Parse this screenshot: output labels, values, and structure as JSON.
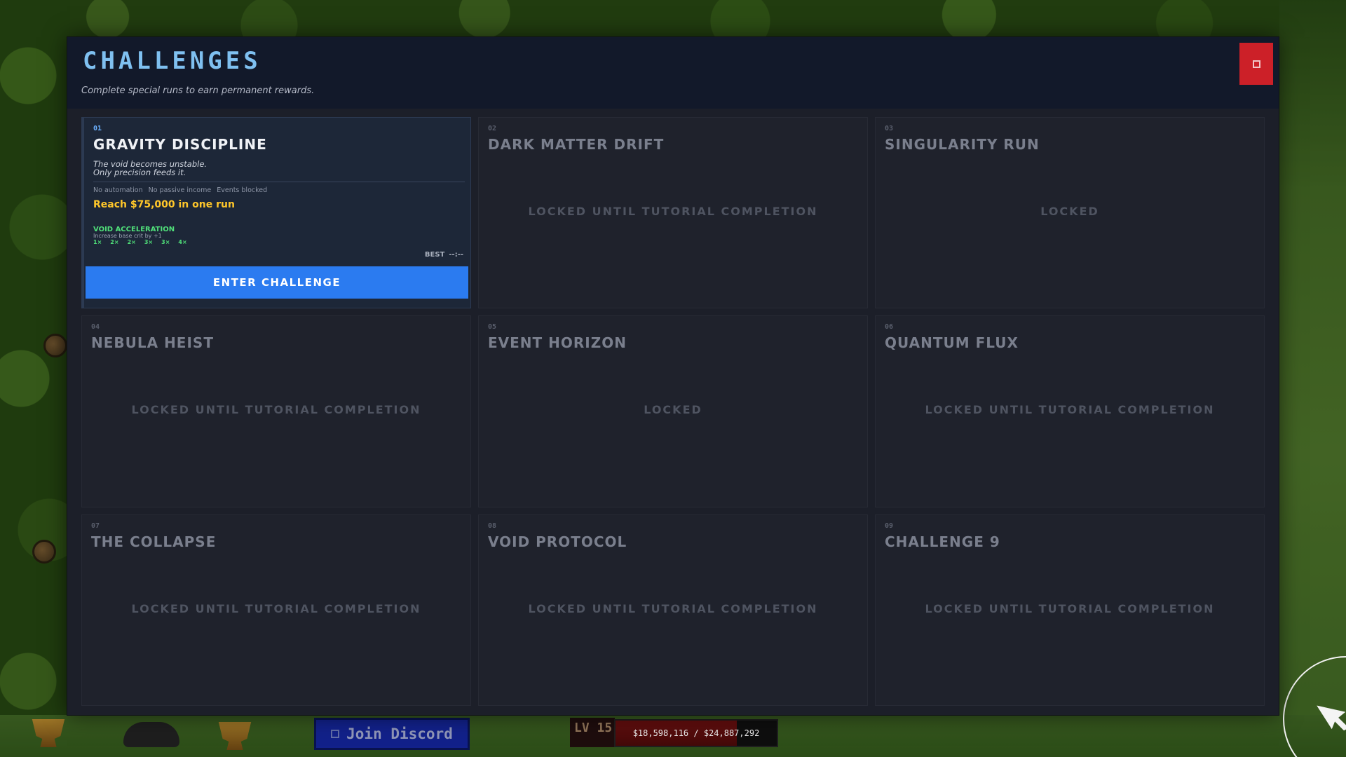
{
  "modal": {
    "title": "CHALLENGES",
    "subtitle": "Complete special runs to earn permanent rewards.",
    "close_icon": "close-icon"
  },
  "challenges": [
    {
      "number": "01",
      "name": "GRAVITY DISCIPLINE",
      "active": true,
      "flavor_line1": "The void becomes unstable.",
      "flavor_line2": "Only precision feeds it.",
      "tags": [
        "No automation",
        "No passive income",
        "Events blocked"
      ],
      "goal": "Reach $75,000 in one run",
      "reward_title": "VOID ACCELERATION",
      "reward_desc": "Increase base crit by +1",
      "tiers": [
        "1×",
        "2×",
        "2×",
        "3×",
        "3×",
        "4×"
      ],
      "best_label": "BEST",
      "best_value": "--:--",
      "button_label": "ENTER CHALLENGE"
    },
    {
      "number": "02",
      "name": "DARK MATTER DRIFT",
      "status": "LOCKED UNTIL TUTORIAL COMPLETION"
    },
    {
      "number": "03",
      "name": "SINGULARITY RUN",
      "status": "LOCKED"
    },
    {
      "number": "04",
      "name": "NEBULA HEIST",
      "status": "LOCKED UNTIL TUTORIAL COMPLETION"
    },
    {
      "number": "05",
      "name": "EVENT HORIZON",
      "status": "LOCKED"
    },
    {
      "number": "06",
      "name": "QUANTUM FLUX",
      "status": "LOCKED UNTIL TUTORIAL COMPLETION"
    },
    {
      "number": "07",
      "name": "THE COLLAPSE",
      "status": "LOCKED UNTIL TUTORIAL COMPLETION"
    },
    {
      "number": "08",
      "name": "VOID PROTOCOL",
      "status": "LOCKED UNTIL TUTORIAL COMPLETION"
    },
    {
      "number": "09",
      "name": "CHALLENGE 9",
      "status": "LOCKED UNTIL TUTORIAL COMPLETION"
    }
  ],
  "hud": {
    "discord_label": "Join Discord",
    "level": "LV 15",
    "money": "$18,598,116 / $24,887,292",
    "money_progress": 0.75
  },
  "colors": {
    "accent": "#2b7bf0",
    "title": "#7fc0f0",
    "goal": "#ffc72a",
    "reward": "#50e07a",
    "close": "#cc2028"
  }
}
